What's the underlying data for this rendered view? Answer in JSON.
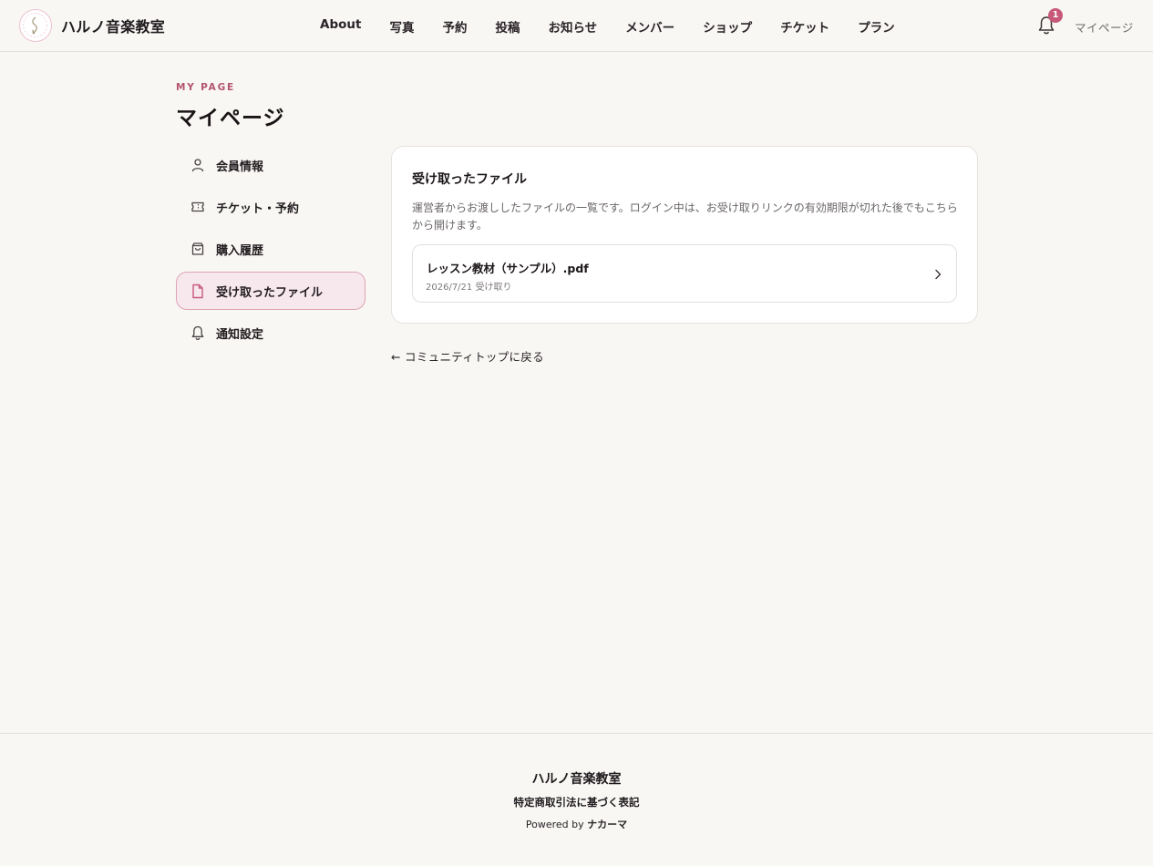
{
  "header": {
    "brand_name": "ハルノ音楽教室",
    "nav": [
      "About",
      "写真",
      "予約",
      "投稿",
      "お知らせ",
      "メンバー",
      "ショップ",
      "チケット",
      "プラン"
    ],
    "notification_count": "1",
    "mypage_label": "マイページ"
  },
  "page": {
    "eyebrow": "MY PAGE",
    "title": "マイページ"
  },
  "sidebar": {
    "items": [
      {
        "label": "会員情報",
        "icon": "user-icon"
      },
      {
        "label": "チケット・予約",
        "icon": "ticket-icon"
      },
      {
        "label": "購入履歴",
        "icon": "shopping-bag-icon"
      },
      {
        "label": "受け取ったファイル",
        "icon": "file-icon",
        "active": true
      },
      {
        "label": "通知設定",
        "icon": "bell-icon"
      }
    ]
  },
  "main": {
    "card_title": "受け取ったファイル",
    "description": "運営者からお渡ししたファイルの一覧です。ログイン中は、お受け取りリンクの有効期限が切れた後でもこちらから開けます。",
    "files": [
      {
        "name": "レッスン教材（サンプル）.pdf",
        "received": "2026/7/21 受け取り"
      }
    ],
    "back_link": "← コミュニティトップに戻る"
  },
  "footer": {
    "brand_name": "ハルノ音楽教室",
    "legal_link": "特定商取引法に基づく表記",
    "powered_prefix": "Powered by",
    "powered_brand": "ナカーマ"
  },
  "colors": {
    "accent": "#c8587a",
    "active_bg": "#f7e8ee",
    "background": "#f8f7f4"
  }
}
